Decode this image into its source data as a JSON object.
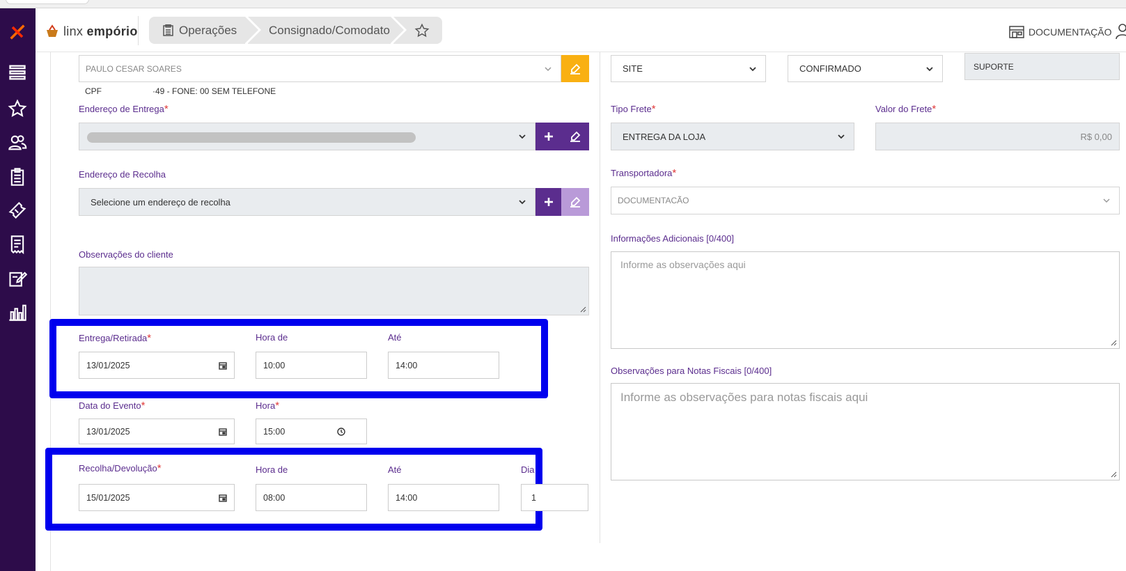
{
  "header": {
    "logo_prefix": "linx",
    "logo_name": "empório",
    "breadcrumbs": [
      "Operações",
      "Consignado/Comodato"
    ],
    "documentation_label": "DOCUMENTAÇÃO"
  },
  "sidebar": {
    "icons": [
      "logo-icon",
      "menu-icon",
      "star-icon",
      "users-icon",
      "clipboard-icon",
      "ticket-icon",
      "receipt-icon",
      "edit-document-icon",
      "chart-icon"
    ]
  },
  "customer": {
    "name": "PAULO CESAR SOARES",
    "doc_label": "CPF",
    "doc_info": "·49 - FONE: 00 SEM TELEFONE"
  },
  "delivery_address": {
    "label": "Endereço de Entrega"
  },
  "pickup_address": {
    "label": "Endereço de Recolha",
    "value": "Selecione um endereço de recolha"
  },
  "customer_notes": {
    "label": "Observações do cliente"
  },
  "delivery": {
    "date_label": "Entrega/Retirada",
    "date": "13/01/2025",
    "from_label": "Hora de",
    "from": "10:00",
    "to_label": "Até",
    "to": "14:00"
  },
  "event": {
    "date_label": "Data do Evento",
    "date": "13/01/2025",
    "time_label": "Hora",
    "time": "15:00"
  },
  "return": {
    "date_label": "Recolha/Devolução",
    "date": "15/01/2025",
    "from_label": "Hora de",
    "from": "08:00",
    "to_label": "Até",
    "to": "14:00",
    "days_label": "Dia",
    "days": "1"
  },
  "right": {
    "channel": "SITE",
    "status": "CONFIRMADO",
    "seller": "SUPORTE",
    "freight_type_label": "Tipo Frete",
    "freight_type": "ENTREGA DA LOJA",
    "freight_value_label": "Valor do Frete",
    "freight_value": "R$ 0,00",
    "carrier_label": "Transportadora",
    "carrier": "DOCUMENTACÃO",
    "additional_info_label": "Informações Adicionais [0/400]",
    "additional_info_placeholder": "Informe as observações aqui",
    "invoice_notes_label": "Observações para Notas Fiscais [0/400]",
    "invoice_notes_placeholder": "Informe as observações para notas fiscais aqui"
  },
  "colors": {
    "sidebar": "#2d0c4a",
    "purple_button": "#5b2d8e",
    "purple_disabled": "#b99ad8",
    "edit_button": "#f9b012",
    "highlight": "#0000ee",
    "label": "#5b2d8e"
  }
}
